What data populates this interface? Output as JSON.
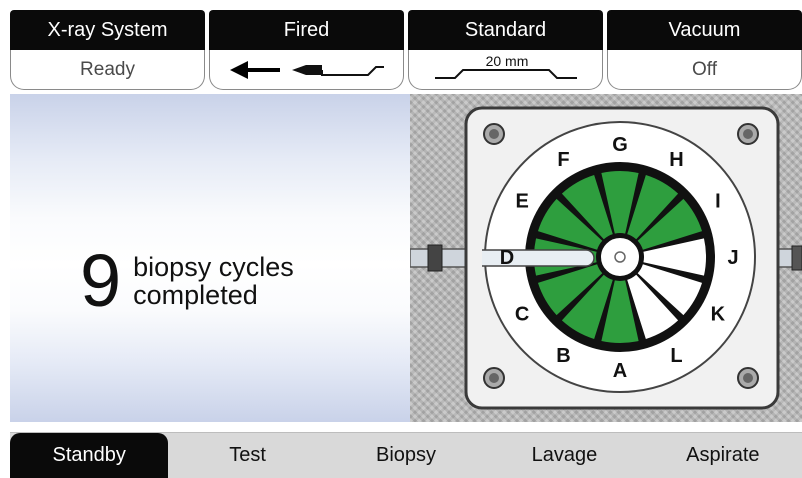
{
  "status": [
    {
      "title": "X-ray System",
      "value": "Ready"
    },
    {
      "title": "Fired",
      "value": ""
    },
    {
      "title": "Standard",
      "value": "20 mm"
    },
    {
      "title": "Vacuum",
      "value": "Off"
    }
  ],
  "cycles": {
    "count": "9",
    "line1": "biopsy cycles",
    "line2": "completed"
  },
  "wheel": {
    "letters": [
      "A",
      "B",
      "C",
      "D",
      "E",
      "F",
      "G",
      "H",
      "I",
      "J",
      "K",
      "L"
    ],
    "colors": {
      "filled": "#2e9e3e",
      "empty": "#ffffff",
      "outline": "#111111"
    },
    "completed_chambers": 9
  },
  "tabs": [
    {
      "label": "Standby",
      "active": true
    },
    {
      "label": "Test"
    },
    {
      "label": "Biopsy"
    },
    {
      "label": "Lavage"
    },
    {
      "label": "Aspirate"
    }
  ]
}
